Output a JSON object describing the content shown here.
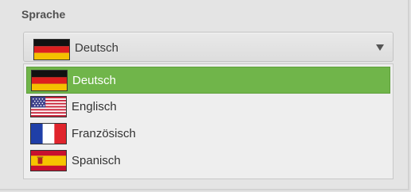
{
  "section": {
    "label": "Sprache"
  },
  "select": {
    "value": "Deutsch",
    "flag_icon": "germany-flag-icon",
    "caret_icon": "chevron-down-icon"
  },
  "options": [
    {
      "label": "Deutsch",
      "flag_icon": "germany-flag-icon",
      "selected": true
    },
    {
      "label": "Englisch",
      "flag_icon": "usa-flag-icon",
      "selected": false
    },
    {
      "label": "Französisch",
      "flag_icon": "france-flag-icon",
      "selected": false
    },
    {
      "label": "Spanisch",
      "flag_icon": "spain-flag-icon",
      "selected": false
    }
  ],
  "colors": {
    "highlight": "#70b54a",
    "panel": "#e4e4e4",
    "list": "#eeeeee"
  }
}
